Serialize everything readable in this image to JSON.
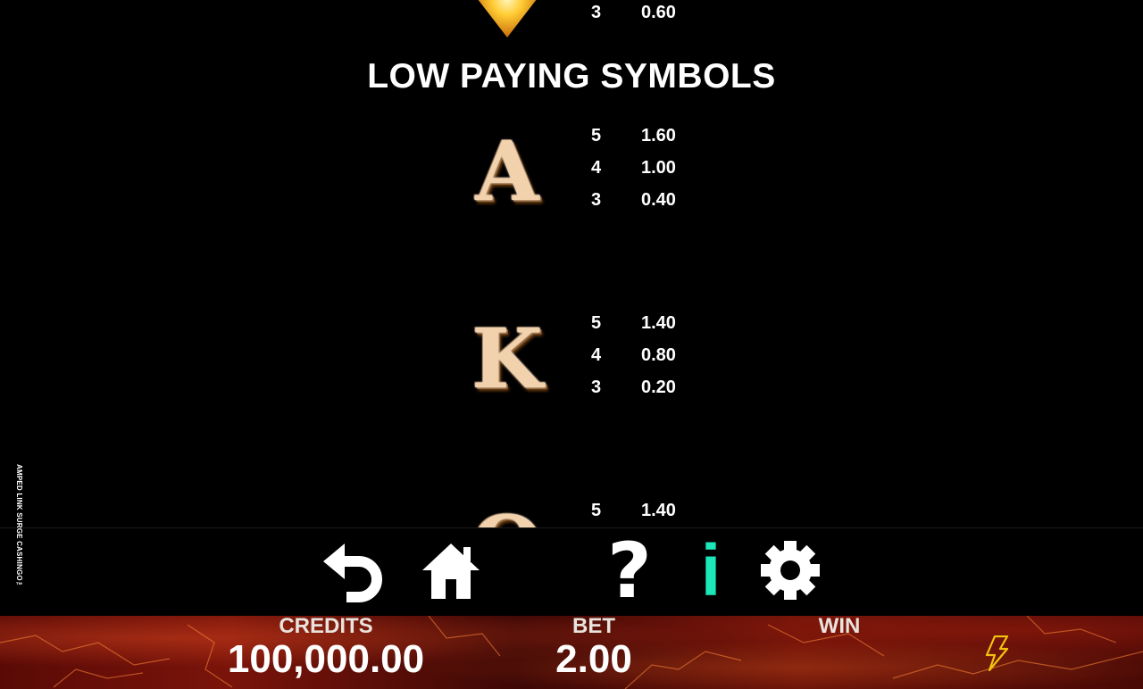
{
  "game_title": "AMPED LINK SURGE CASHINGO™",
  "paytable": {
    "top_row": {
      "count": "3",
      "value": "0.60"
    },
    "section_title": "LOW PAYING SYMBOLS",
    "symbols": [
      {
        "letter": "A",
        "pays": [
          {
            "count": "5",
            "value": "1.60"
          },
          {
            "count": "4",
            "value": "1.00"
          },
          {
            "count": "3",
            "value": "0.40"
          }
        ]
      },
      {
        "letter": "K",
        "pays": [
          {
            "count": "5",
            "value": "1.40"
          },
          {
            "count": "4",
            "value": "0.80"
          },
          {
            "count": "3",
            "value": "0.20"
          }
        ]
      },
      {
        "letter": "Q",
        "pays": [
          {
            "count": "5",
            "value": "1.40"
          }
        ]
      }
    ]
  },
  "toolbar": {
    "back_icon": "undo-arrow-icon",
    "home_icon": "home-icon",
    "help_label": "?",
    "info_label": "i",
    "settings_icon": "gear-icon",
    "info_color": "#1de7b8"
  },
  "bottom_bar": {
    "credits_label": "CREDITS",
    "credits_value": "100,000.00",
    "bet_label": "BET",
    "bet_value": "2.00",
    "win_label": "WIN",
    "bolt_icon": "lightning-bolt-icon",
    "bolt_color": "#f4c20d"
  }
}
